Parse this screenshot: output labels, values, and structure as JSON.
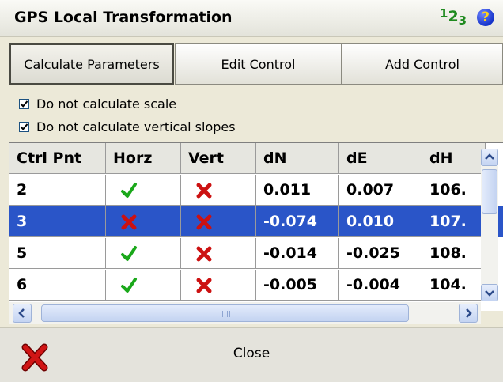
{
  "window": {
    "title": "GPS Local Transformation",
    "num_icon": {
      "d1": "1",
      "d2": "2",
      "d3": "3"
    },
    "help_glyph": "?",
    "icons": [
      "numeric-input-icon",
      "help-icon"
    ]
  },
  "tabs": [
    {
      "label": "Calculate Parameters",
      "active": true
    },
    {
      "label": "Edit Control",
      "active": false
    },
    {
      "label": "Add Control",
      "active": false
    }
  ],
  "options": [
    {
      "label": "Do not calculate scale",
      "checked": true
    },
    {
      "label": "Do not calculate vertical slopes",
      "checked": true
    }
  ],
  "table": {
    "columns": [
      "Ctrl Pnt",
      "Horz",
      "Vert",
      "dN",
      "dE",
      "dH"
    ],
    "rows": [
      {
        "pnt": "2",
        "horz": "check-icon",
        "vert": "cross-icon",
        "dN": "0.011",
        "dE": "0.007",
        "dH": "106.",
        "selected": false
      },
      {
        "pnt": "3",
        "horz": "cross-icon",
        "vert": "cross-icon",
        "dN": "-0.074",
        "dE": "0.010",
        "dH": "107.",
        "selected": true
      },
      {
        "pnt": "5",
        "horz": "check-icon",
        "vert": "cross-icon",
        "dN": "-0.014",
        "dE": "-0.025",
        "dH": "108.",
        "selected": false
      },
      {
        "pnt": "6",
        "horz": "check-icon",
        "vert": "cross-icon",
        "dN": "-0.005",
        "dE": "-0.004",
        "dH": "104.",
        "selected": false
      }
    ]
  },
  "footer": {
    "close_label": "Close",
    "close_icon": "close-icon"
  },
  "colors": {
    "selection": "#2a55c8",
    "check": "#1aa81a",
    "cross": "#cc1111",
    "numeric_icon": "#1f8a1f"
  }
}
